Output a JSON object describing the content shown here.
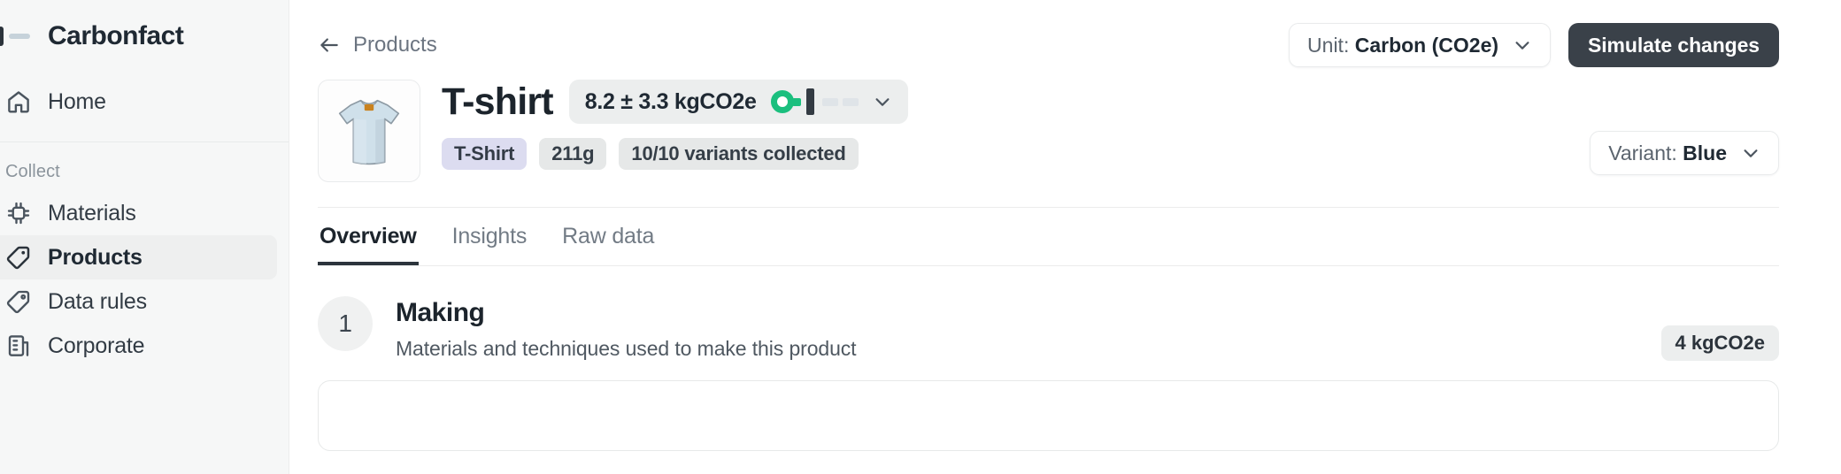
{
  "sidebar": {
    "brand": {
      "name": "Carbonfact",
      "mark_icon": "carbonfact-logo-icon"
    },
    "primary_items": [
      {
        "label": "Home",
        "icon": "home-icon",
        "active": false
      }
    ],
    "section_label": "Collect",
    "collect_items": [
      {
        "label": "Materials",
        "icon": "chip-icon",
        "active": false
      },
      {
        "label": "Products",
        "icon": "product-tag-icon",
        "active": true
      },
      {
        "label": "Data rules",
        "icon": "tag-rule-icon",
        "active": false
      },
      {
        "label": "Corporate",
        "icon": "building-icon",
        "active": false
      }
    ]
  },
  "topbar": {
    "back_label": "Products",
    "back_icon": "arrow-left-icon",
    "unit_prefix": "Unit: ",
    "unit_value": "Carbon (CO2e)",
    "unit_caret_icon": "chevron-down-icon",
    "simulate_label": "Simulate changes"
  },
  "product": {
    "thumbnail_icon": "tshirt-thumbnail",
    "title": "T-shirt",
    "emission": {
      "value": "8.2 ± 3.3 kgCO2e",
      "caret_icon": "chevron-down-icon",
      "gauge_marker_icon": "gauge-marker",
      "gauge_dot_icon": "gauge-dot"
    },
    "tags": [
      {
        "label": "T-Shirt",
        "style": "lilac"
      },
      {
        "label": "211g",
        "style": "grey"
      },
      {
        "label": "10/10 variants collected",
        "style": "grey"
      }
    ],
    "variant_prefix": "Variant: ",
    "variant_value": "Blue",
    "variant_caret_icon": "chevron-down-icon"
  },
  "tabs": [
    {
      "label": "Overview",
      "active": true
    },
    {
      "label": "Insights",
      "active": false
    },
    {
      "label": "Raw data",
      "active": false
    }
  ],
  "section": {
    "step": "1",
    "title": "Making",
    "subtitle": "Materials and techniques used to make this product",
    "amount": "4 kgCO2e"
  },
  "colors": {
    "accent_green": "#1bbf7e",
    "dark_button": "#3a4149",
    "sidebar_bg": "#f6f7f7",
    "active_nav_bg": "#eeefef",
    "lilac_tag": "#dcdcf0"
  }
}
